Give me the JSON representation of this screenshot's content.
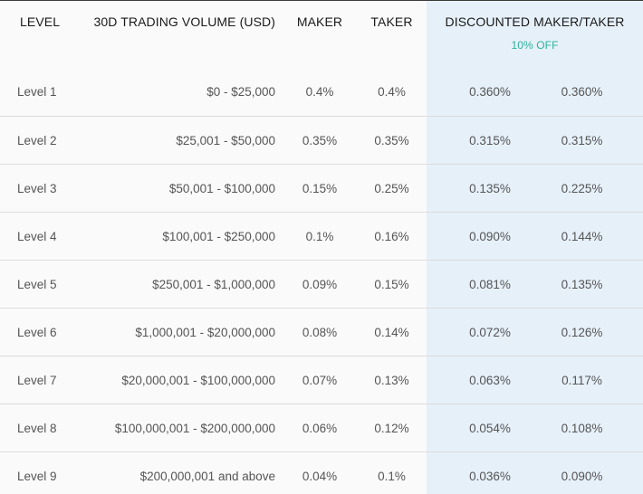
{
  "headers": {
    "level": "LEVEL",
    "volume": "30D TRADING VOLUME (USD)",
    "maker": "MAKER",
    "taker": "TAKER",
    "discounted": "DISCOUNTED MAKER/TAKER",
    "discount_badge": "10% OFF"
  },
  "colors": {
    "discount_column_bg": "#e6f0f9",
    "discount_badge": "#2bb39a",
    "row_divider": "#dcdcdc"
  },
  "rows": [
    {
      "level": "Level 1",
      "volume": "$0 - $25,000",
      "maker": "0.4%",
      "taker": "0.4%",
      "d_maker": "0.360%",
      "d_taker": "0.360%"
    },
    {
      "level": "Level 2",
      "volume": "$25,001 - $50,000",
      "maker": "0.35%",
      "taker": "0.35%",
      "d_maker": "0.315%",
      "d_taker": "0.315%"
    },
    {
      "level": "Level 3",
      "volume": "$50,001 - $100,000",
      "maker": "0.15%",
      "taker": "0.25%",
      "d_maker": "0.135%",
      "d_taker": "0.225%"
    },
    {
      "level": "Level 4",
      "volume": "$100,001 - $250,000",
      "maker": "0.1%",
      "taker": "0.16%",
      "d_maker": "0.090%",
      "d_taker": "0.144%"
    },
    {
      "level": "Level 5",
      "volume": "$250,001 - $1,000,000",
      "maker": "0.09%",
      "taker": "0.15%",
      "d_maker": "0.081%",
      "d_taker": "0.135%"
    },
    {
      "level": "Level 6",
      "volume": "$1,000,001 - $20,000,000",
      "maker": "0.08%",
      "taker": "0.14%",
      "d_maker": "0.072%",
      "d_taker": "0.126%"
    },
    {
      "level": "Level 7",
      "volume": "$20,000,001 - $100,000,000",
      "maker": "0.07%",
      "taker": "0.13%",
      "d_maker": "0.063%",
      "d_taker": "0.117%"
    },
    {
      "level": "Level 8",
      "volume": "$100,000,001 - $200,000,000",
      "maker": "0.06%",
      "taker": "0.12%",
      "d_maker": "0.054%",
      "d_taker": "0.108%"
    },
    {
      "level": "Level 9",
      "volume": "$200,000,001 and above",
      "maker": "0.04%",
      "taker": "0.1%",
      "d_maker": "0.036%",
      "d_taker": "0.090%"
    }
  ]
}
